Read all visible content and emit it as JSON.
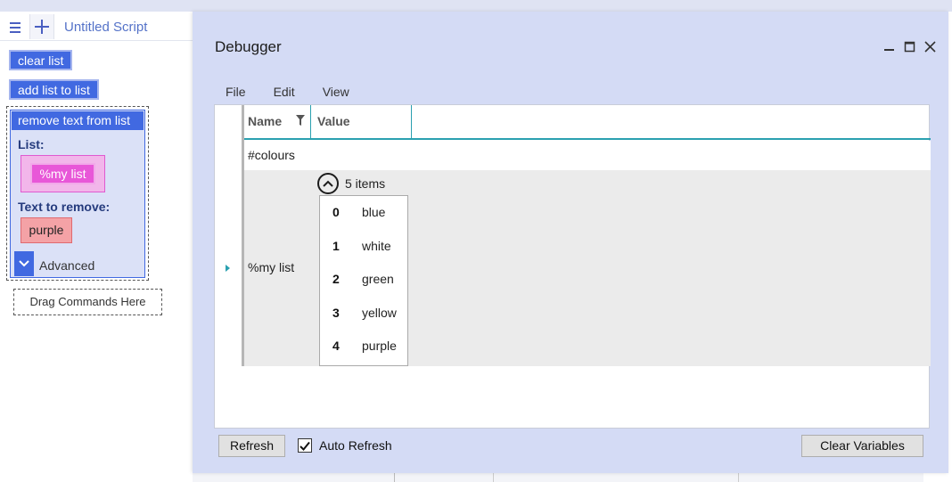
{
  "editor": {
    "script_title": "Untitled Script",
    "commands": {
      "clear_list": "clear list",
      "add_list_to_list": "add list to list",
      "remove_text_from_list": "remove text from list"
    },
    "remove_card": {
      "list_label": "List:",
      "list_value": "%my list",
      "text_label": "Text to remove:",
      "text_value": "purple",
      "advanced_label": "Advanced"
    },
    "drop_zone": "Drag Commands Here"
  },
  "debugger": {
    "title": "Debugger",
    "menu": [
      "File",
      "Edit",
      "View"
    ],
    "columns": {
      "name": "Name",
      "value": "Value"
    },
    "rows": [
      {
        "name": "#colours"
      },
      {
        "name": "%my list",
        "count_label": "5 items",
        "items": [
          {
            "index": "0",
            "value": "blue"
          },
          {
            "index": "1",
            "value": "white"
          },
          {
            "index": "2",
            "value": "green"
          },
          {
            "index": "3",
            "value": "yellow"
          },
          {
            "index": "4",
            "value": "purple"
          }
        ]
      }
    ],
    "refresh_label": "Refresh",
    "auto_refresh_label": "Auto Refresh",
    "auto_refresh_checked": true,
    "clear_variables_label": "Clear Variables"
  },
  "colors": {
    "accent_blue": "#4169e1",
    "debugger_bg": "#d4dbf5",
    "list_chip": "#e857d8",
    "text_chip": "#f4a2a6",
    "header_line": "#2aa0b0"
  }
}
